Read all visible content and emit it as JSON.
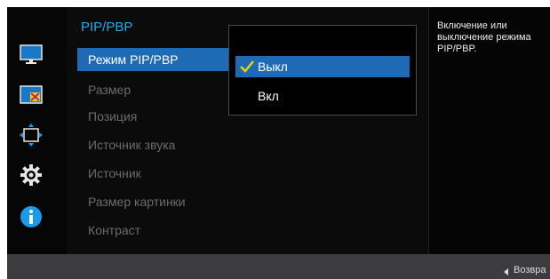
{
  "menu": {
    "title": "PIP/PBP",
    "items": [
      {
        "label": "Режим PIP/PBP",
        "selected": true
      },
      {
        "label": "Размер",
        "selected": false
      },
      {
        "label": "Позиция",
        "selected": false
      },
      {
        "label": "Источник звука",
        "selected": false
      },
      {
        "label": "Источник",
        "selected": false
      },
      {
        "label": "Размер картинки",
        "selected": false
      },
      {
        "label": "Контраст",
        "selected": false
      }
    ]
  },
  "submenu": {
    "options": [
      {
        "label": "Выкл",
        "selected": true,
        "checked": true
      },
      {
        "label": "Вкл",
        "selected": false,
        "checked": false
      }
    ]
  },
  "help": {
    "text": "Включение или выключение режима PIP/PBP."
  },
  "footer": {
    "return_label": "Возвра"
  },
  "rail": {
    "icons": [
      "monitor-icon",
      "pip-pbp-icon",
      "position-size-icon",
      "settings-gear-icon",
      "info-icon"
    ],
    "active_icon": "pip-pbp-icon"
  },
  "colors": {
    "accent": "#1f6ab4",
    "title": "#29a9e8",
    "check": "#e8d010",
    "inactive_text": "#6b6b6b"
  }
}
